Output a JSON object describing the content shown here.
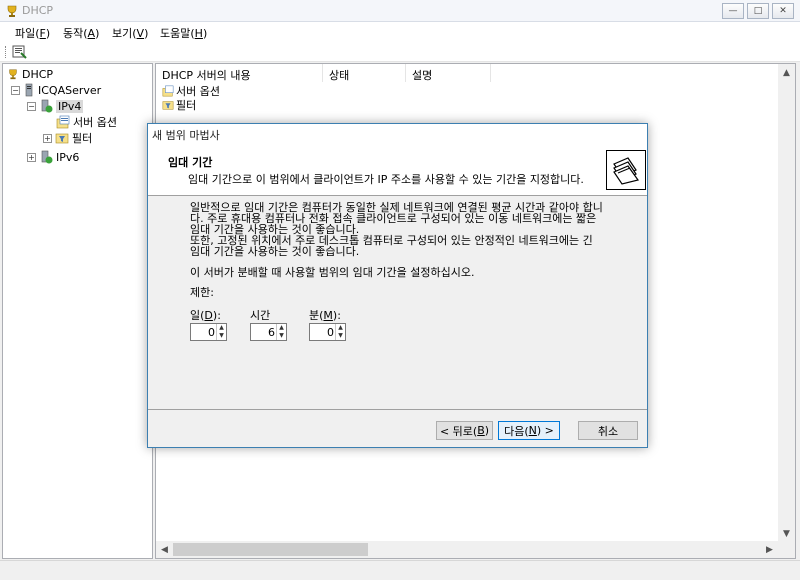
{
  "window": {
    "title": "DHCP"
  },
  "menu": [
    {
      "label": "파일(",
      "key": "F",
      "suffix": ")"
    },
    {
      "label": "동작(",
      "key": "A",
      "suffix": ")"
    },
    {
      "label": "보기(",
      "key": "V",
      "suffix": ")"
    },
    {
      "label": "도움말(",
      "key": "H",
      "suffix": ")"
    }
  ],
  "tree": {
    "root": "DHCP",
    "server": "ICQAServer",
    "ipv4": "IPv4",
    "server_options": "서버 옵션",
    "filters": "필터",
    "ipv6": "IPv6"
  },
  "content": {
    "columns": [
      "DHCP 서버의 내용",
      "상태",
      "설명"
    ],
    "rows": [
      "서버 옵션",
      "필터"
    ]
  },
  "wizard": {
    "title": "새 범위 마법사",
    "header_title": "임대 기간",
    "header_subtitle": "임대 기간으로 이 범위에서 클라이언트가 IP 주소를 사용할 수 있는 기간을 지정합니다.",
    "para_lines": [
      "일반적으로 임대 기간은 컴퓨터가 동일한 실제 네트워크에 연결된 평균 시간과 같아야 합니",
      "다. 주로 휴대용 컴퓨터나 전화 접속 클라이언트로 구성되어 있는 이동 네트워크에는 짧은",
      "임대 기간을 사용하는 것이 좋습니다.",
      "또한, 고정된 위치에서 주로 데스크톱 컴퓨터로 구성되어 있는 안정적인 네트워크에는 긴",
      "임대 기간을 사용하는 것이 좋습니다."
    ],
    "instruction": "이 서버가 분배할 때 사용할 범위의 임대 기간을 설정하십시오.",
    "limit_label": "제한:",
    "fields": {
      "days": {
        "label": "일(",
        "key": "D",
        "suffix": "):",
        "value": "0"
      },
      "hours": {
        "label": "시간",
        "value": "6"
      },
      "minutes": {
        "label": "분(",
        "key": "M",
        "suffix": "):",
        "value": "0"
      }
    },
    "buttons": {
      "back": {
        "label": "< 뒤로(",
        "key": "B",
        "suffix": ")"
      },
      "next": {
        "label": "다음(",
        "key": "N",
        "suffix": ") >"
      },
      "cancel": "취소"
    }
  },
  "colors": {
    "accent": "#0078d7",
    "dialog_border": "#3c7fb1",
    "selection": "#d9d9d9"
  },
  "icons": {
    "app": "dhcp-trophy-icon",
    "wizard": "folders-icon"
  }
}
